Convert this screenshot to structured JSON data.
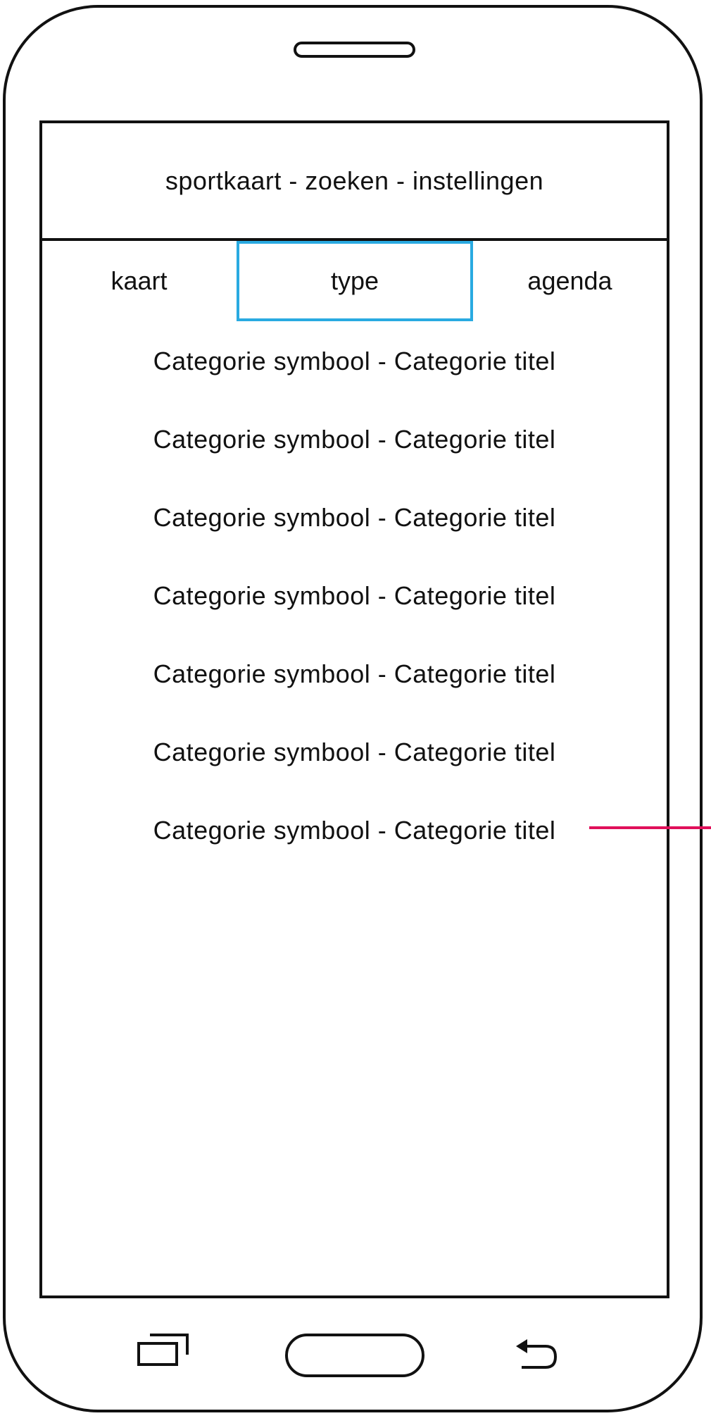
{
  "header": {
    "title": "sportkaart - zoeken - instellingen"
  },
  "tabs": [
    {
      "label": "kaart",
      "selected": false
    },
    {
      "label": "type",
      "selected": true
    },
    {
      "label": "agenda",
      "selected": false
    }
  ],
  "categories": [
    "Categorie symbool - Categorie titel",
    "Categorie symbool - Categorie titel",
    "Categorie symbool - Categorie titel",
    "Categorie symbool - Categorie titel",
    "Categorie symbool - Categorie titel",
    "Categorie symbool - Categorie titel",
    "Categorie symbool - Categorie titel"
  ],
  "nav_bar": {
    "icons": [
      "recent-apps-icon",
      "home-button",
      "back-icon"
    ]
  },
  "colors": {
    "selected_tab_border": "#29aae1",
    "annotation_line": "#e0105a",
    "outline": "#111111"
  }
}
